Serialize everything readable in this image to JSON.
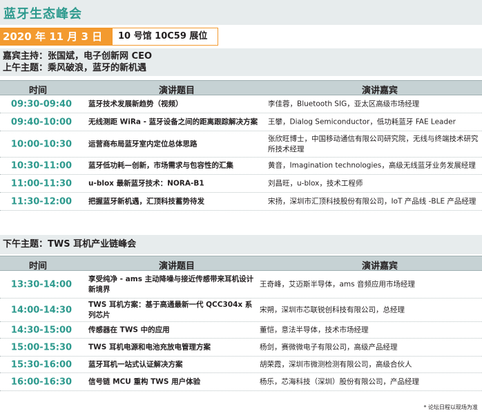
{
  "title": "蓝牙生态峰会",
  "date": "2020 年 11 月 3 日",
  "venue": "10 号馆 10C59 展位",
  "host_line": "嘉宾主持：张国斌，电子创新网 CEO",
  "am_theme": "上午主题：乘风破浪，蓝牙的新机遇",
  "pm_theme": "下午主题：TWS 耳机产业链峰会",
  "headers": {
    "time": "时间",
    "topic": "演讲题目",
    "speaker": "演讲嘉宾"
  },
  "am_sessions": [
    {
      "time": "09:30-09:40",
      "topic": "蓝牙技术发展新趋势（视频）",
      "speaker": "李佳蓉，Bluetooth SIG，亚太区高级市场经理"
    },
    {
      "time": "09:40-10:00",
      "topic": "无线测距 WiRa - 蓝牙设备之间的距离跟踪解决方案",
      "speaker": "王攀，Dialog Semiconductor，低功耗蓝牙 FAE Leader"
    },
    {
      "time": "10:00-10:30",
      "topic": "运营商布局蓝牙室内定位总体思路",
      "speaker": "张欣旺博士，中国移动通信有限公司研究院，无线与终端技术研究所技术经理"
    },
    {
      "time": "10:30-11:00",
      "topic": "蓝牙低功耗—创新，市场需求与包容性的汇集",
      "speaker": "黄音，Imagination technologies，高级无线蓝牙业务发展经理"
    },
    {
      "time": "11:00-11:30",
      "topic": "u-blox 最新蓝牙技术：NORA-B1",
      "speaker": "刘昌旺，u-blox，技术工程师"
    },
    {
      "time": "11:30-12:00",
      "topic": "把握蓝牙新机遇，汇顶科技蓄势待发",
      "speaker": "宋扬，深圳市汇顶科技股份有限公司，IoT 产品线 -BLE 产品经理"
    }
  ],
  "pm_sessions": [
    {
      "time": "13:30-14:00",
      "topic": "享受纯净 - ams 主动降噪与接近传感带来耳机设计新境界",
      "speaker": "王奇峰，艾迈斯半导体，ams 音频应用市场经理"
    },
    {
      "time": "14:00-14:30",
      "topic": "TWS 耳机方案：基于高通最新一代 QCC304x 系列芯片",
      "speaker": "宋朔，深圳市芯联锐创科技有限公司，总经理"
    },
    {
      "time": "14:30-15:00",
      "topic": "传感器在 TWS 中的应用",
      "speaker": "董恺，意法半导体，技术市场经理"
    },
    {
      "time": "15:00-15:30",
      "topic": "TWS 耳机电源和电池充放电管理方案",
      "speaker": "杨剑，赛微微电子有限公司，高级产品经理"
    },
    {
      "time": "15:30-16:00",
      "topic": "蓝牙耳机一站式认证解决方案",
      "speaker": "胡荣霞，深圳市微测检测有限公司，高级合伙人"
    },
    {
      "time": "16:00-16:30",
      "topic": "信号链 MCU 重构 TWS 用户体验",
      "speaker": "杨乐，芯海科技（深圳）股份有限公司，产品经理"
    }
  ],
  "footnote": "* 论坛日程以现场为准"
}
